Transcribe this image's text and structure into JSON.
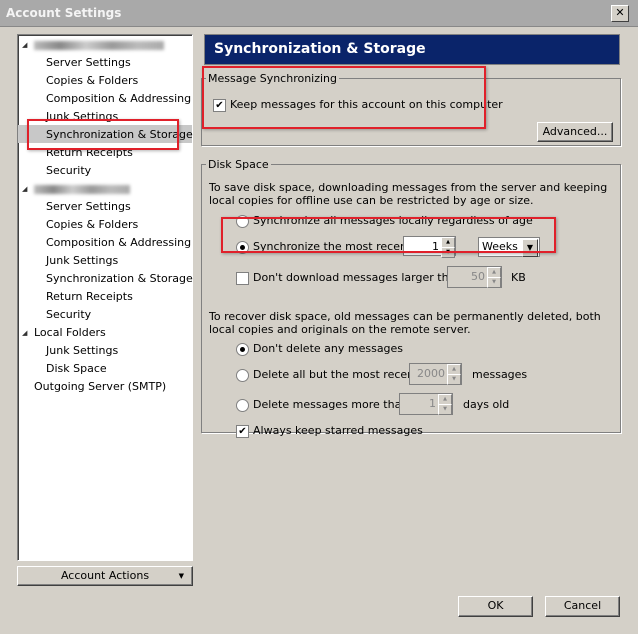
{
  "window": {
    "title": "Account Settings",
    "close": "✕"
  },
  "sidebar": {
    "account1_items": [
      "Server Settings",
      "Copies & Folders",
      "Composition & Addressing",
      "Junk Settings",
      "Synchronization & Storage",
      "Return Receipts",
      "Security"
    ],
    "account2_items": [
      "Server Settings",
      "Copies & Folders",
      "Composition & Addressing",
      "Junk Settings",
      "Synchronization & Storage",
      "Return Receipts",
      "Security"
    ],
    "local_folders": {
      "label": "Local Folders",
      "items": [
        "Junk Settings",
        "Disk Space"
      ]
    },
    "outgoing": "Outgoing Server (SMTP)",
    "selected": "Synchronization & Storage",
    "account_actions": "Account Actions"
  },
  "main": {
    "header": "Synchronization & Storage",
    "msg_sync": {
      "legend": "Message Synchronizing",
      "keep_label": "Keep messages for this account on this computer",
      "keep_checked": true,
      "advanced": "Advanced..."
    },
    "disk": {
      "legend": "Disk Space",
      "intro": "To save disk space, downloading messages from the server and keeping local copies for offline use can be restricted by age or size.",
      "sync_all": "Synchronize all messages locally regardless of age",
      "sync_recent": "Synchronize the most recent",
      "sync_recent_value": "1",
      "sync_unit": "Weeks",
      "dont_download": "Don't download messages larger than",
      "size_value": "50",
      "size_unit": "KB",
      "recover": "To recover disk space, old messages can be permanently deleted, both local copies and originals on the remote server.",
      "dont_delete": "Don't delete any messages",
      "delete_all_but": "Delete all but the most recent",
      "count_value": "2000",
      "count_unit": "messages",
      "delete_older": "Delete messages more than",
      "days_value": "1",
      "days_unit": "days old",
      "keep_starred": "Always keep starred messages"
    }
  },
  "footer": {
    "ok": "OK",
    "cancel": "Cancel"
  },
  "colors": {
    "header_bg": "#0a246a",
    "highlight": "#e0202a"
  }
}
